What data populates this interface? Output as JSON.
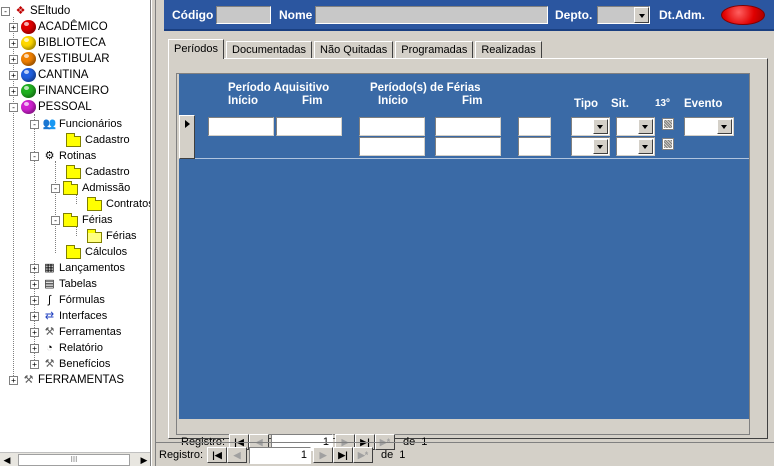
{
  "tree": {
    "root": "SEltudo",
    "modules": [
      {
        "label": "ACADÊMICO",
        "color": "#e00000"
      },
      {
        "label": "BIBLIOTECA",
        "color": "#ffd800"
      },
      {
        "label": "VESTIBULAR",
        "color": "#f08000"
      },
      {
        "label": "CANTINA",
        "color": "#2060e0"
      },
      {
        "label": "FINANCEIRO",
        "color": "#20b020"
      },
      {
        "label": "PESSOAL",
        "color": "#d020d0"
      }
    ],
    "pessoal": {
      "funcionarios": "Funcionários",
      "func_cadastro": "Cadastro",
      "rotinas": "Rotinas",
      "rot_cadastro": "Cadastro",
      "admissao": "Admissão",
      "contratos": "Contratos",
      "ferias": "Férias",
      "ferias_child": "Férias",
      "calculos": "Cálculos",
      "lancamentos": "Lançamentos",
      "tabelas": "Tabelas",
      "formulas": "Fórmulas",
      "interfaces": "Interfaces",
      "ferramentas": "Ferramentas",
      "relatorio": "Relatório",
      "beneficios": "Benefícios"
    },
    "ferramentas_root": "FERRAMENTAS",
    "scroll_thumb": "III"
  },
  "header": {
    "codigo_label": "Código",
    "nome_label": "Nome",
    "depto_label": "Depto.",
    "dtadm_label": "Dt.Adm.",
    "codigo_value": "",
    "nome_value": "",
    "depto_value": "",
    "status_color": "#e00000"
  },
  "tabs": [
    "Períodos",
    "Documentadas",
    "Não Quitadas",
    "Programadas",
    "Realizadas"
  ],
  "grid": {
    "group_aquisitivo": "Período Aquisitivo",
    "group_ferias": "Período(s) de Férias",
    "inicio": "Início",
    "fim": "Fim",
    "inicio2": "Início",
    "fim2": "Fim",
    "tipo": "Tipo",
    "sit": "Sit.",
    "decimo": "13º",
    "evento": "Evento"
  },
  "subnav": {
    "label": "Registro:",
    "current": "1",
    "of": "de",
    "total": "1"
  },
  "mainnav": {
    "label": "Registro:",
    "current": "1",
    "of": "de",
    "total": "1"
  },
  "nav_glyphs": {
    "first": "|◀",
    "prev": "◀",
    "next": "▶",
    "last": "▶|",
    "new": "▶*"
  }
}
